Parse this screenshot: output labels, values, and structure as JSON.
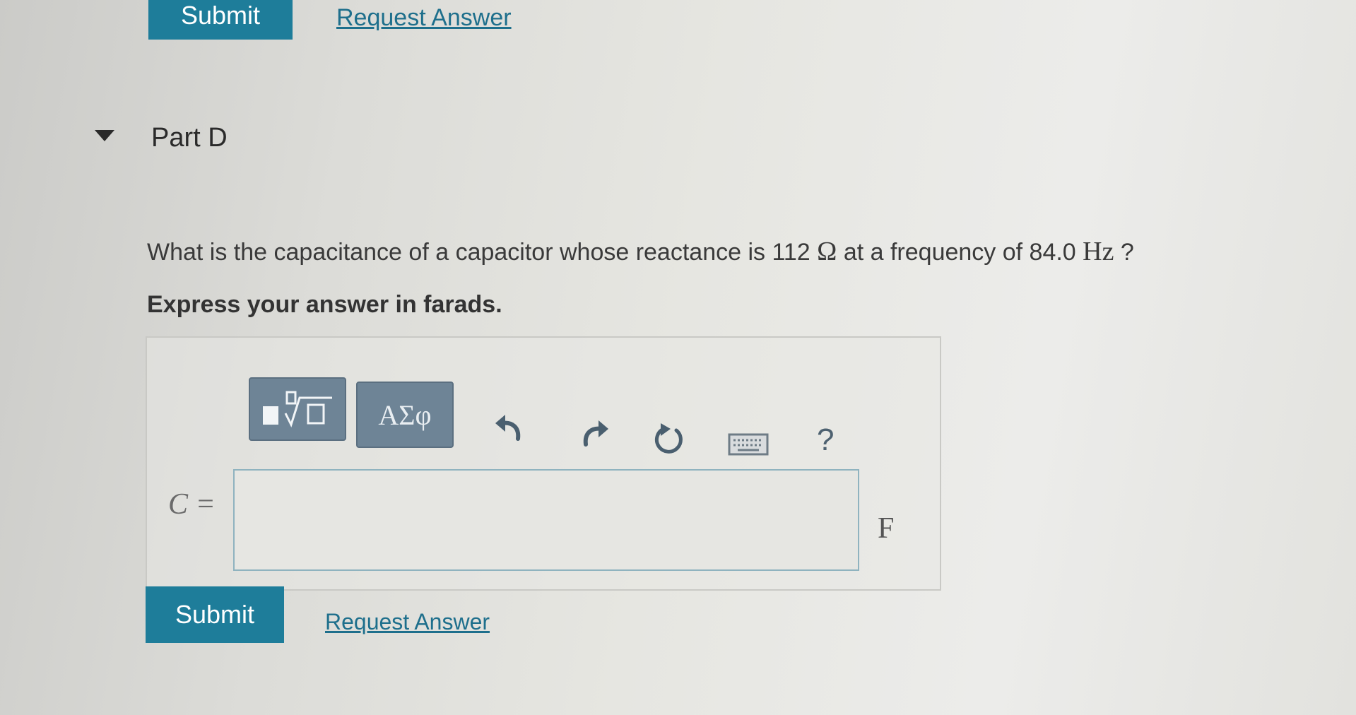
{
  "previous_part": {
    "submit_label": "Submit",
    "request_answer_label": "Request Answer"
  },
  "part": {
    "title": "Part D",
    "question_prefix": "What is the capacitance of a capacitor whose reactance is 112 ",
    "question_ohm": "Ω",
    "question_middle": " at a frequency of 84.0 ",
    "question_hz": "Hz",
    "question_suffix": " ?",
    "instruction": "Express your answer in farads."
  },
  "toolbar": {
    "greek_label": "ΑΣφ",
    "help_label": "?",
    "icons": [
      "templates-icon",
      "greek-symbols-icon",
      "undo-icon",
      "redo-icon",
      "reset-icon",
      "keyboard-icon",
      "help-icon"
    ]
  },
  "answer": {
    "variable_label": "C =",
    "value": "",
    "unit": "F"
  },
  "actions": {
    "submit_label": "Submit",
    "request_answer_label": "Request Answer"
  },
  "colors": {
    "accent": "#1e7d9a",
    "link": "#1e6f8c",
    "toolbar_button": "#6e8496"
  }
}
